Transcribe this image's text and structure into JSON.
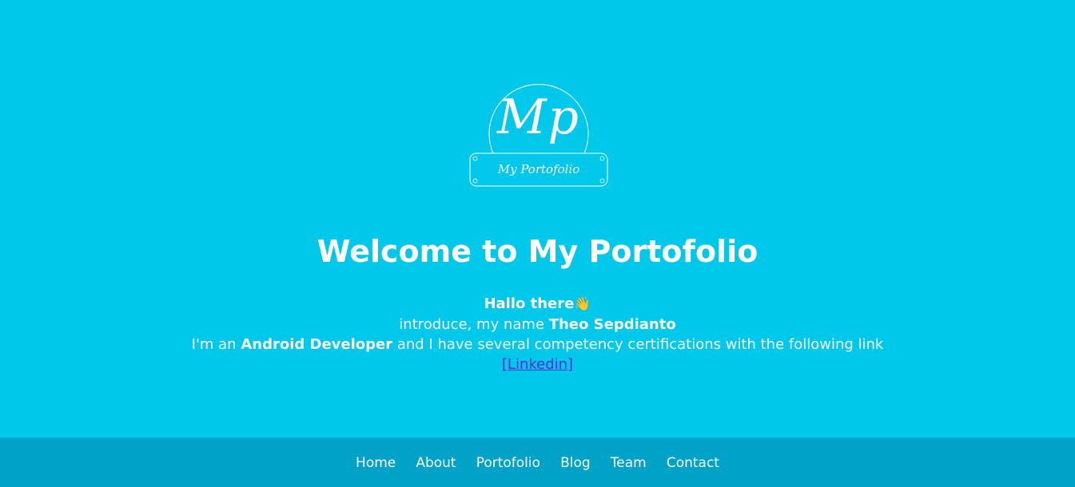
{
  "logo": {
    "monogram": "Mp",
    "text": "My Portofolio"
  },
  "hero": {
    "title": "Welcome to My Portofolio",
    "greeting": "Hallo there",
    "greeting_emoji": "👋",
    "intro_prefix": "introduce, my name ",
    "name": "Theo Sepdianto",
    "role_prefix": "I'm an ",
    "role": "Android Developer",
    "role_suffix": " and I have several competency certifications with the following link",
    "link_label": "[Linkedin]"
  },
  "nav": {
    "items": [
      "Home",
      "About",
      "Portofolio",
      "Blog",
      "Team",
      "Contact"
    ]
  },
  "colors": {
    "hero_bg": "#00c8eb",
    "footer_bg": "#00a2c8",
    "link": "#5b2bd6",
    "text": "#ffffff"
  }
}
